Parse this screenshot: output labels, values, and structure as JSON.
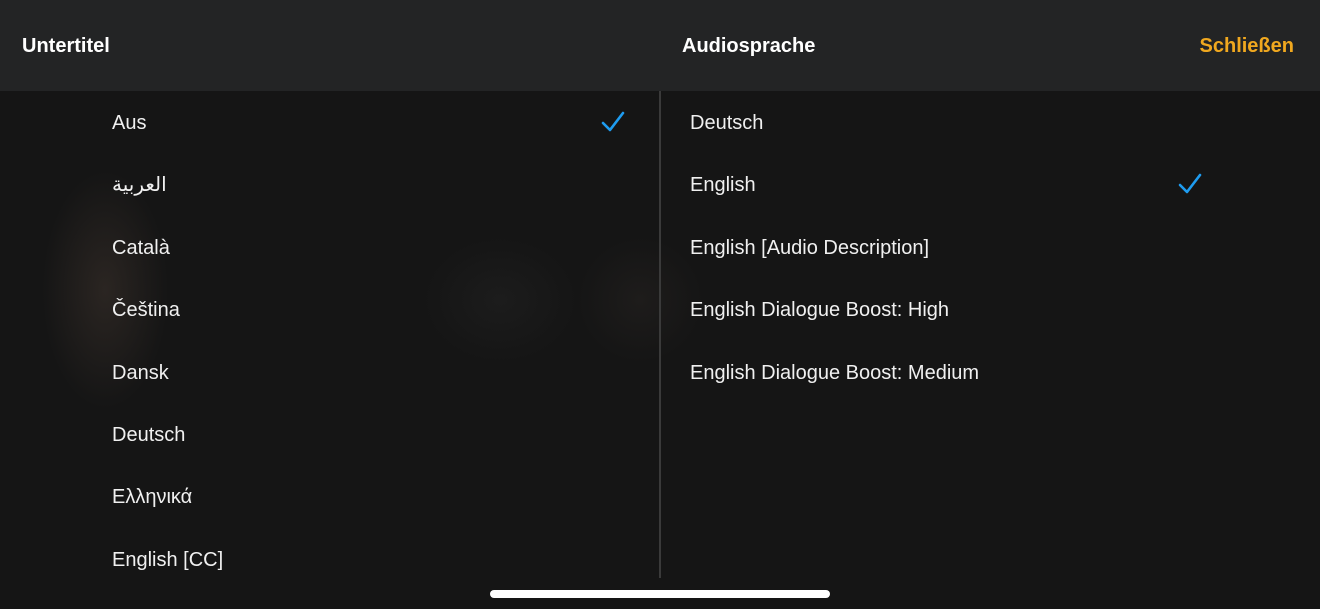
{
  "header": {
    "subtitles_title": "Untertitel",
    "audio_title": "Audiosprache",
    "close_label": "Schließen"
  },
  "colors": {
    "accent": "#f0a81f",
    "check": "#1e9cf0",
    "background": "#151515",
    "header_background": "#232425"
  },
  "subtitles": {
    "selected_index": 0,
    "items": [
      {
        "label": "Aus",
        "selected": true
      },
      {
        "label": "العربية",
        "selected": false
      },
      {
        "label": "Català",
        "selected": false
      },
      {
        "label": "Čeština",
        "selected": false
      },
      {
        "label": "Dansk",
        "selected": false
      },
      {
        "label": "Deutsch",
        "selected": false
      },
      {
        "label": "Ελληνικά",
        "selected": false
      },
      {
        "label": "English [CC]",
        "selected": false
      }
    ]
  },
  "audio": {
    "selected_index": 1,
    "items": [
      {
        "label": "Deutsch",
        "selected": false
      },
      {
        "label": "English",
        "selected": true
      },
      {
        "label": "English [Audio Description]",
        "selected": false
      },
      {
        "label": "English Dialogue Boost: High",
        "selected": false
      },
      {
        "label": "English Dialogue Boost: Medium",
        "selected": false
      }
    ]
  },
  "icons": {
    "selected_marker": "checkmark-icon"
  }
}
